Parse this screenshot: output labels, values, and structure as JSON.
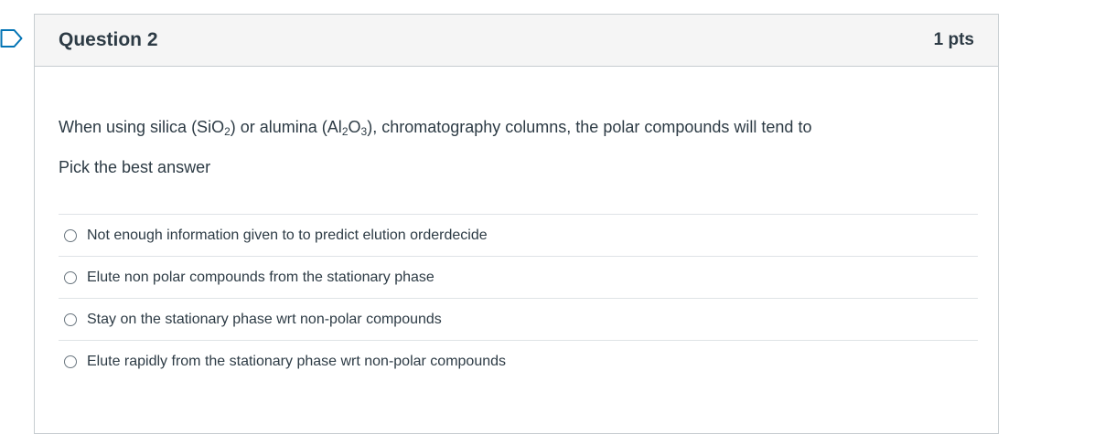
{
  "question": {
    "title": "Question 2",
    "points": "1 pts",
    "text_before_1": "When using silica (SiO",
    "sub_1": "2",
    "text_before_2": ") or alumina (Al",
    "sub_2": "2",
    "text_before_3": "O",
    "sub_3": "3",
    "text_after": "), chromatography columns, the polar compounds will tend to",
    "instruction": "Pick the best answer"
  },
  "answers": [
    {
      "label": "Not enough information given to to predict elution orderdecide",
      "selected": false
    },
    {
      "label": "Elute non polar compounds from the stationary phase",
      "selected": false
    },
    {
      "label": "Stay on the stationary phase wrt non-polar compounds",
      "selected": false
    },
    {
      "label": "Elute rapidly from the stationary phase wrt non-polar compounds",
      "selected": false
    }
  ],
  "icons": {
    "flag": "bookmark-flag-icon"
  },
  "colors": {
    "text": "#2d3b45",
    "header_bg": "#f5f5f5",
    "border": "#c7cdd1",
    "flag_stroke": "#0374b5"
  }
}
